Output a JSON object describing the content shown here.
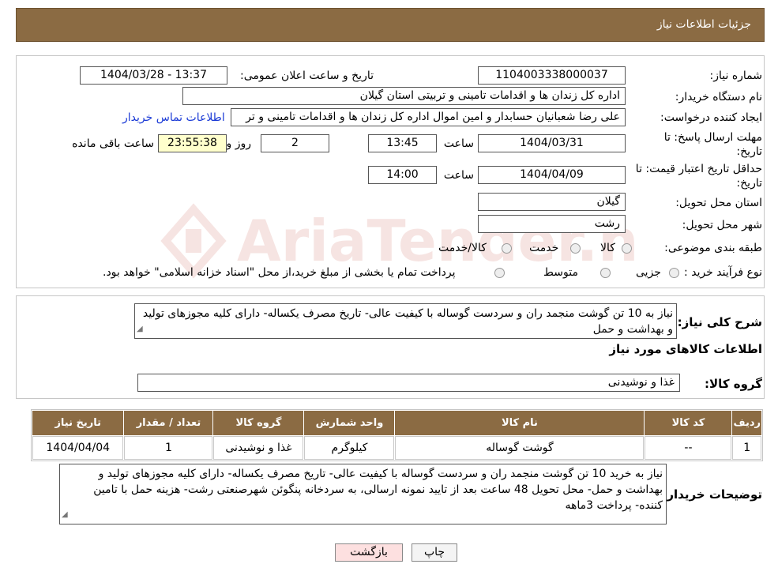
{
  "header": {
    "title": "جزئیات اطلاعات نیاز"
  },
  "form": {
    "need_number_label": "شماره نیاز:",
    "need_number": "1104003338000037",
    "announce_label": "تاریخ و ساعت اعلان عمومی:",
    "announce_value": "1404/03/28 - 13:37",
    "buyer_org_label": "نام دستگاه خریدار:",
    "buyer_org": "اداره کل زندان ها و اقدامات تامینی و تربیتی استان گیلان",
    "requester_label": "ایجاد کننده درخواست:",
    "requester": "علی رضا شعبانیان حسابدار و امین اموال اداره کل زندان ها و اقدامات تامینی و تر",
    "contact_link": "اطلاعات تماس خریدار",
    "deadline_label_1": "مهلت ارسال پاسخ: تا",
    "deadline_label_2": "تاریخ:",
    "deadline_date": "1404/03/31",
    "time_label": "ساعت",
    "deadline_time": "13:45",
    "days_value": "2",
    "days_label": "روز و",
    "remaining_time": "23:55:38",
    "remaining_label": "ساعت باقی مانده",
    "validity_label_1": "حداقل تاریخ اعتبار قیمت: تا",
    "validity_label_2": "تاریخ:",
    "validity_date": "1404/04/09",
    "validity_time_label": "ساعت",
    "validity_time": "14:00",
    "province_label": "استان محل تحویل:",
    "province": "گیلان",
    "city_label": "شهر محل تحویل:",
    "city": "رشت",
    "category_label": "طبقه بندی موضوعی:",
    "category_options": [
      "کالا",
      "خدمت",
      "کالا/خدمت"
    ],
    "process_label": "نوع فرآیند خرید :",
    "process_options": [
      "جزیی",
      "متوسط"
    ],
    "process_note": "پرداخت تمام یا بخشی از مبلغ خرید،از محل \"اسناد خزانه اسلامی\" خواهد بود."
  },
  "summary": {
    "label": "شرح کلی نیاز:",
    "text": "نیاز به 10 تن گوشت منجمد ران و سردست گوساله با کیفیت عالی- تاریخ مصرف یکساله- دارای کلیه مجوزهای تولید و بهداشت و حمل"
  },
  "goods_info": {
    "heading": "اطلاعات کالاهای مورد نیاز",
    "group_label": "گروه کالا:",
    "group_value": "غذا و نوشیدنی"
  },
  "table": {
    "headers": [
      "ردیف",
      "کد کالا",
      "نام کالا",
      "واحد شمارش",
      "گروه کالا",
      "تعداد / مقدار",
      "تاریخ نیاز"
    ],
    "rows": [
      [
        "1",
        "--",
        "گوشت گوساله",
        "کیلوگرم",
        "غذا و نوشیدنی",
        "1",
        "1404/04/04"
      ]
    ]
  },
  "buyer_notes": {
    "label": "توضیحات خریدار:",
    "text": "نیاز به خرید 10 تن گوشت منجمد ران و سردست گوساله با کیفیت عالی- تاریخ مصرف یکساله- دارای کلیه مجوزهای تولید و بهداشت و حمل- محل تحویل 48 ساعت بعد از تایید نمونه ارسالی، به سردخانه پنگوئن شهرصنعتی رشت- هزینه حمل با تامین کننده- پرداخت 3ماهه"
  },
  "buttons": {
    "print": "چاپ",
    "back": "بازگشت"
  },
  "watermark": "AriaTender.neT",
  "colors": {
    "header_bg": "#8b6b43",
    "back_button_bg": "#fde0e0",
    "remaining_bg": "#ffffcc",
    "link": "#1a3ad6"
  }
}
